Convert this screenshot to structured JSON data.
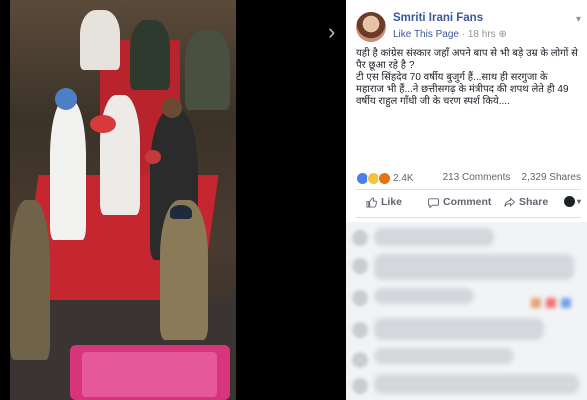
{
  "page": {
    "name": "Smriti Irani Fans",
    "like_link": "Like This Page",
    "time": "18 hrs",
    "privacy_icon": "globe-icon",
    "options_icon": "chevron-down-icon"
  },
  "post": {
    "message": "यही है कांग्रेस संस्कार जहाँ अपने बाप से भी बड़े उम्र के लोगों से पैर छूआ रहे है ?\nटी एस सिंहदेव 70 वर्षीय बुजुर्ग हैं...साथ ही सरगुजा के महाराज भी हैं...ने छत्तीसगढ़ के मंत्रीपद की शपथ लेते ही 49 वर्षीय राहुल गाँधी जी के चरण स्पर्श किये...."
  },
  "stats": {
    "reactions": "2.4K",
    "reaction_icons": [
      "like-reaction-icon",
      "haha-reaction-icon",
      "angry-reaction-icon"
    ],
    "comments": "213 Comments",
    "shares": "2,329 Shares"
  },
  "actions": {
    "like": "Like",
    "comment": "Comment",
    "share": "Share"
  },
  "colors": {
    "link": "#385898",
    "carpet_red": "#c62630",
    "phone_pink": "#d8347c"
  }
}
